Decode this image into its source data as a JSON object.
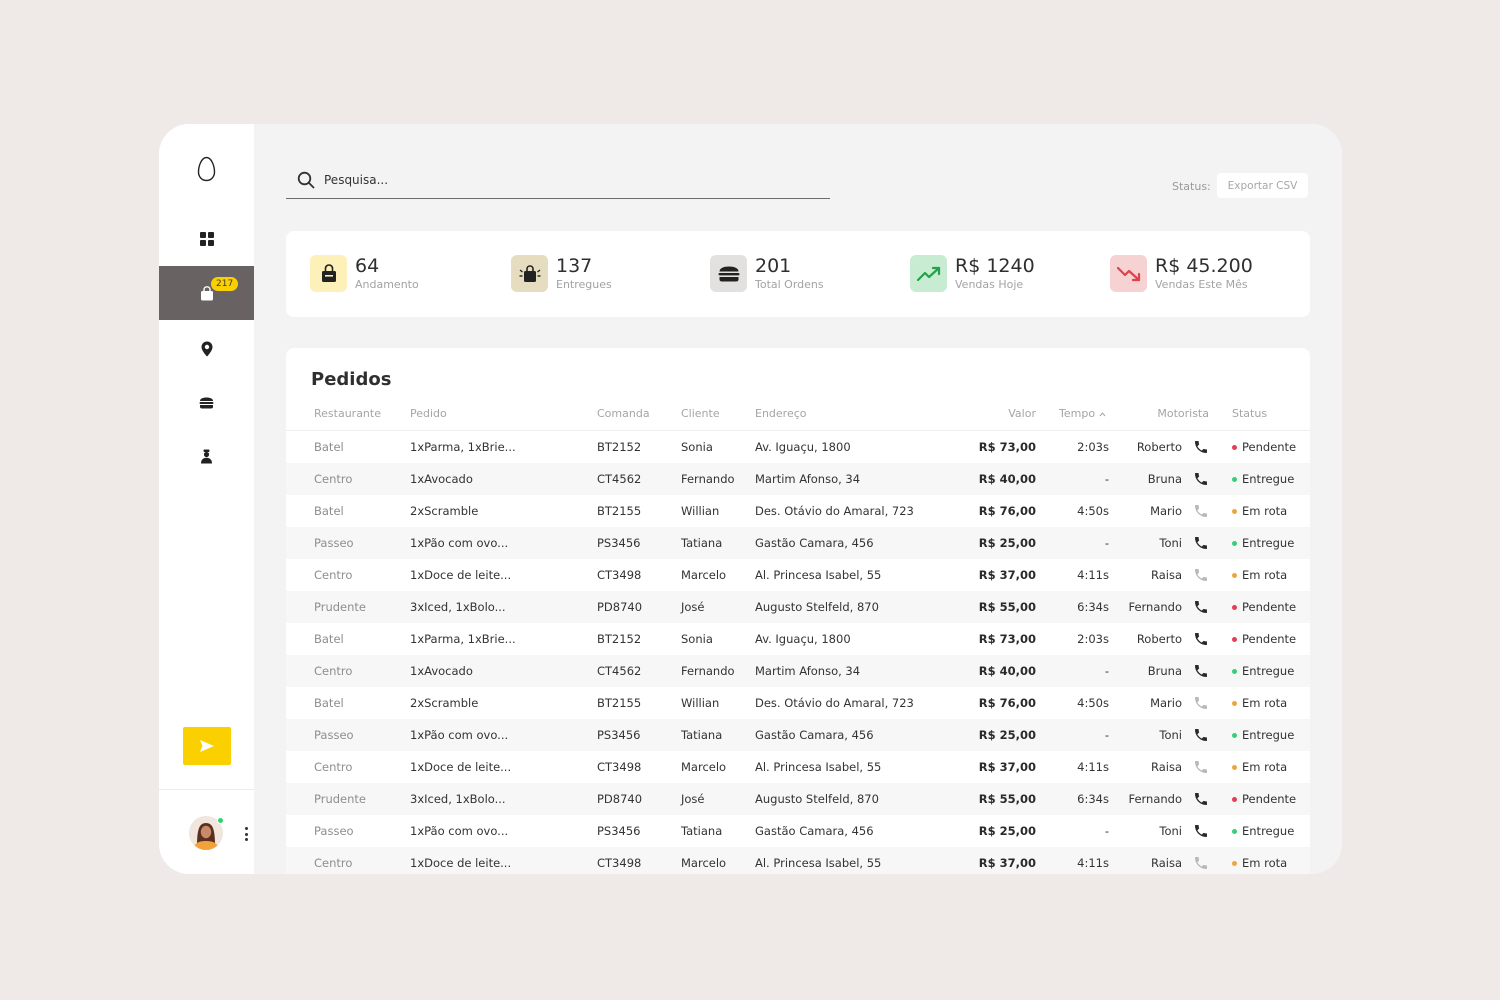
{
  "sidebar": {
    "logo_icon": "egg-icon",
    "nav": [
      {
        "id": "dashboard",
        "icon": "grid-icon"
      },
      {
        "id": "orders",
        "icon": "bag-icon",
        "badge": "217",
        "active": true
      },
      {
        "id": "locations",
        "icon": "map-pin-icon"
      },
      {
        "id": "menu",
        "icon": "burger-icon"
      },
      {
        "id": "drivers",
        "icon": "driver-icon"
      }
    ],
    "send_icon": "send-icon",
    "accent": "#fbd000",
    "active_bg": "#686262",
    "online_color": "#33d26c"
  },
  "header": {
    "search_placeholder": "Pesquisa...",
    "status_label": "Status:",
    "export_label": "Exportar CSV"
  },
  "stats": [
    {
      "value": "64",
      "label": "Andamento",
      "icon": "lock-bag-icon",
      "bg": "#fdf0b9"
    },
    {
      "value": "137",
      "label": "Entregues",
      "icon": "delivered-bag-icon",
      "bg": "#e6dcc0"
    },
    {
      "value": "201",
      "label": "Total Ordens",
      "icon": "burger-icon",
      "bg": "#e3e1df"
    },
    {
      "value": "R$ 1240",
      "label": "Vendas Hoje",
      "icon": "trend-up-icon",
      "bg": "#c8ecd2",
      "color": "#23a24a"
    },
    {
      "value": "R$ 45.200",
      "label": "Vendas Este Mês",
      "icon": "trend-down-icon",
      "bg": "#f6d2d2",
      "color": "#e0414a"
    }
  ],
  "orders": {
    "title": "Pedidos",
    "columns": {
      "restaurante": "Restaurante",
      "pedido": "Pedido",
      "comanda": "Comanda",
      "cliente": "Cliente",
      "endereco": "Endereço",
      "valor": "Valor",
      "tempo": "Tempo",
      "motorista": "Motorista",
      "status": "Status"
    },
    "status_colors": {
      "Pendente": "#e0414a",
      "Entregue": "#33d26c",
      "Em rota": "#f0a53a"
    },
    "rows": [
      {
        "restaurante": "Batel",
        "pedido": "1xParma, 1xBrie...",
        "comanda": "BT2152",
        "cliente": "Sonia",
        "endereco": "Av. Iguaçu, 1800",
        "valor": "R$ 73,00",
        "tempo": "2:03s",
        "motorista": "Roberto",
        "phone_active": true,
        "status": "Pendente"
      },
      {
        "restaurante": "Centro",
        "pedido": "1xAvocado",
        "comanda": "CT4562",
        "cliente": "Fernando",
        "endereco": "Martim Afonso, 34",
        "valor": "R$ 40,00",
        "tempo": "-",
        "motorista": "Bruna",
        "phone_active": true,
        "status": "Entregue"
      },
      {
        "restaurante": "Batel",
        "pedido": "2xScramble",
        "comanda": "BT2155",
        "cliente": "Willian",
        "endereco": "Des. Otávio do Amaral, 723",
        "valor": "R$ 76,00",
        "tempo": "4:50s",
        "motorista": "Mario",
        "phone_active": false,
        "status": "Em rota"
      },
      {
        "restaurante": "Passeo",
        "pedido": "1xPão com ovo...",
        "comanda": "PS3456",
        "cliente": "Tatiana",
        "endereco": "Gastão Camara, 456",
        "valor": "R$ 25,00",
        "tempo": "-",
        "motorista": "Toni",
        "phone_active": true,
        "status": "Entregue"
      },
      {
        "restaurante": "Centro",
        "pedido": "1xDoce de leite...",
        "comanda": "CT3498",
        "cliente": "Marcelo",
        "endereco": "Al. Princesa Isabel, 55",
        "valor": "R$ 37,00",
        "tempo": "4:11s",
        "motorista": "Raisa",
        "phone_active": false,
        "status": "Em rota"
      },
      {
        "restaurante": "Prudente",
        "pedido": "3xIced, 1xBolo...",
        "comanda": "PD8740",
        "cliente": "José",
        "endereco": "Augusto Stelfeld, 870",
        "valor": "R$ 55,00",
        "tempo": "6:34s",
        "motorista": "Fernando",
        "phone_active": true,
        "status": "Pendente"
      },
      {
        "restaurante": "Batel",
        "pedido": "1xParma, 1xBrie...",
        "comanda": "BT2152",
        "cliente": "Sonia",
        "endereco": "Av. Iguaçu, 1800",
        "valor": "R$ 73,00",
        "tempo": "2:03s",
        "motorista": "Roberto",
        "phone_active": true,
        "status": "Pendente"
      },
      {
        "restaurante": "Centro",
        "pedido": "1xAvocado",
        "comanda": "CT4562",
        "cliente": "Fernando",
        "endereco": "Martim Afonso, 34",
        "valor": "R$ 40,00",
        "tempo": "-",
        "motorista": "Bruna",
        "phone_active": true,
        "status": "Entregue"
      },
      {
        "restaurante": "Batel",
        "pedido": "2xScramble",
        "comanda": "BT2155",
        "cliente": "Willian",
        "endereco": "Des. Otávio do Amaral, 723",
        "valor": "R$ 76,00",
        "tempo": "4:50s",
        "motorista": "Mario",
        "phone_active": false,
        "status": "Em rota"
      },
      {
        "restaurante": "Passeo",
        "pedido": "1xPão com ovo...",
        "comanda": "PS3456",
        "cliente": "Tatiana",
        "endereco": "Gastão Camara, 456",
        "valor": "R$ 25,00",
        "tempo": "-",
        "motorista": "Toni",
        "phone_active": true,
        "status": "Entregue"
      },
      {
        "restaurante": "Centro",
        "pedido": "1xDoce de leite...",
        "comanda": "CT3498",
        "cliente": "Marcelo",
        "endereco": "Al. Princesa Isabel, 55",
        "valor": "R$ 37,00",
        "tempo": "4:11s",
        "motorista": "Raisa",
        "phone_active": false,
        "status": "Em rota"
      },
      {
        "restaurante": "Prudente",
        "pedido": "3xIced, 1xBolo...",
        "comanda": "PD8740",
        "cliente": "José",
        "endereco": "Augusto Stelfeld, 870",
        "valor": "R$ 55,00",
        "tempo": "6:34s",
        "motorista": "Fernando",
        "phone_active": true,
        "status": "Pendente"
      },
      {
        "restaurante": "Passeo",
        "pedido": "1xPão com ovo...",
        "comanda": "PS3456",
        "cliente": "Tatiana",
        "endereco": "Gastão Camara, 456",
        "valor": "R$ 25,00",
        "tempo": "-",
        "motorista": "Toni",
        "phone_active": true,
        "status": "Entregue"
      },
      {
        "restaurante": "Centro",
        "pedido": "1xDoce de leite...",
        "comanda": "CT3498",
        "cliente": "Marcelo",
        "endereco": "Al. Princesa Isabel, 55",
        "valor": "R$ 37,00",
        "tempo": "4:11s",
        "motorista": "Raisa",
        "phone_active": false,
        "status": "Em rota"
      }
    ]
  }
}
